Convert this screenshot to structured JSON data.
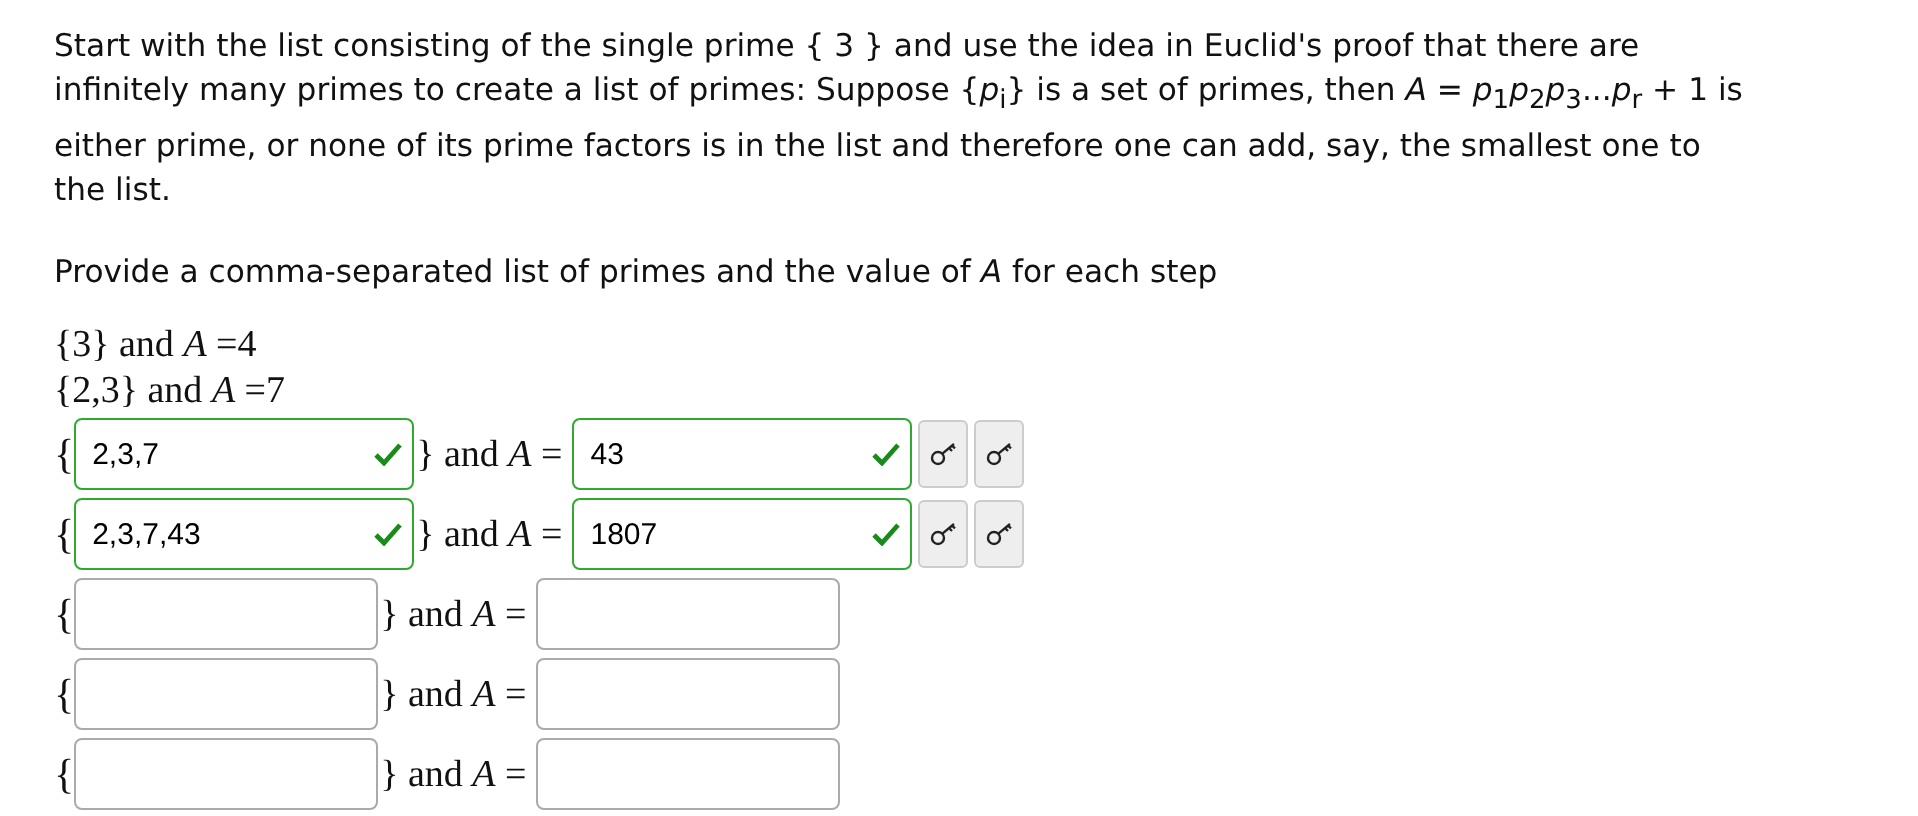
{
  "intro": "Start with the list consisting of the single prime { 3 } and use the idea in Euclid's proof that there are infinitely many primes to create a list of primes: Suppose {*p*$_{i}$} is a set of primes, then *A* = *p*$_{1}$*p*$_{2}$*p*$_{3}$...*p*$_{r}$ + 1 is either prime, or none of its prime factors is in the list and therefore one can add, say, the smallest one to the list.",
  "instruction": "Provide a comma-separated list of primes and the value of *A* for each step",
  "given": [
    "{3} and *A* =4",
    "{2,3} and *A* =7"
  ],
  "rows": [
    {
      "open": "{",
      "set": {
        "value": "2,3,7",
        "correct": true
      },
      "middle": "} and *A* =",
      "a": {
        "value": "43",
        "correct": true
      }
    },
    {
      "open": "{",
      "set": {
        "value": "2,3,7,43",
        "correct": true
      },
      "middle": "} and *A* =",
      "a": {
        "value": "1807",
        "correct": true
      }
    },
    {
      "open": "{",
      "set": {
        "correct": false
      },
      "middle": "} and *A* =",
      "a": {
        "correct": false
      }
    },
    {
      "open": "{",
      "set": {
        "correct": false
      },
      "middle": "} and *A* =",
      "a": {
        "correct": false
      }
    },
    {
      "open": "{",
      "set": {
        "correct": false
      },
      "middle": "} and *A* =",
      "a": {
        "correct": false
      }
    }
  ]
}
